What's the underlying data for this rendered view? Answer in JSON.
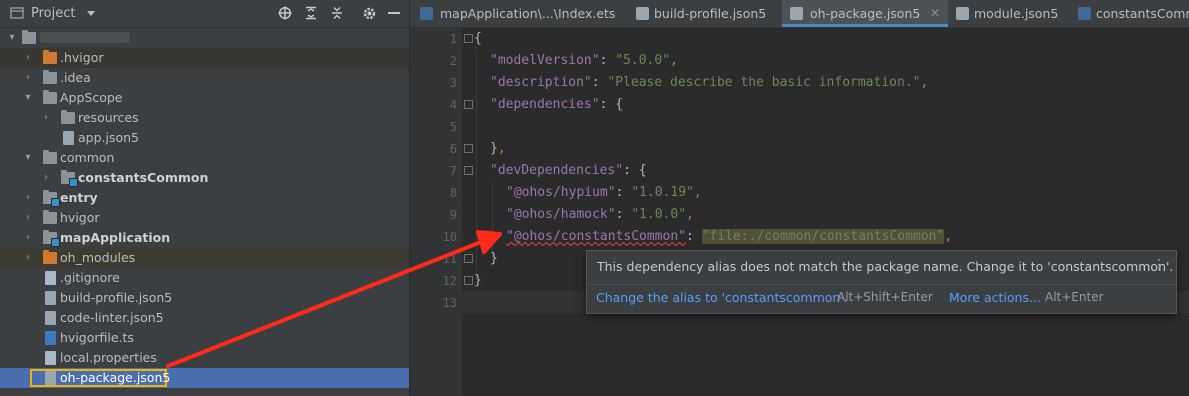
{
  "project_panel": {
    "title": "Project",
    "tree": [
      {
        "label": "",
        "type": "root-blurred"
      },
      {
        "label": ".hvigor",
        "type": "folder-orange"
      },
      {
        "label": ".idea",
        "type": "folder"
      },
      {
        "label": "AppScope",
        "type": "folder"
      },
      {
        "label": "resources",
        "type": "folder"
      },
      {
        "label": "app.json5",
        "type": "json"
      },
      {
        "label": "common",
        "type": "folder"
      },
      {
        "label": "constantsCommon",
        "type": "module"
      },
      {
        "label": "entry",
        "type": "module"
      },
      {
        "label": "hvigor",
        "type": "folder"
      },
      {
        "label": "mapApplication",
        "type": "module"
      },
      {
        "label": "oh_modules",
        "type": "folder-orange"
      },
      {
        "label": ".gitignore",
        "type": "file"
      },
      {
        "label": "build-profile.json5",
        "type": "json"
      },
      {
        "label": "code-linter.json5",
        "type": "json"
      },
      {
        "label": "hvigorfile.ts",
        "type": "ts"
      },
      {
        "label": "local.properties",
        "type": "props"
      },
      {
        "label": "oh-package.json5",
        "type": "json"
      }
    ]
  },
  "tabs": [
    {
      "label": "mapApplication\\...\\Index.ets",
      "icon": "ets-icon"
    },
    {
      "label": "build-profile.json5",
      "icon": "json-icon"
    },
    {
      "label": "oh-package.json5",
      "icon": "json-icon",
      "active": true
    },
    {
      "label": "module.json5",
      "icon": "json-icon"
    },
    {
      "label": "constantsComme",
      "icon": "ets-icon"
    }
  ],
  "line_numbers": [
    "1",
    "2",
    "3",
    "4",
    "5",
    "6",
    "7",
    "8",
    "9",
    "10",
    "11",
    "12",
    "13"
  ],
  "code": {
    "l1": "{",
    "l2_key": "\"modelVersion\"",
    "l2_val": "\"5.0.0\"",
    "l3_key": "\"description\"",
    "l3_val": "\"Please describe the basic information.\"",
    "l4_key": "\"dependencies\"",
    "l4_open": "{",
    "l6_close": "}",
    "l7_key": "\"devDependencies\"",
    "l7_open": "{",
    "l8_key": "\"@ohos/hypium\"",
    "l8_val": "\"1.0.19\"",
    "l9_key": "\"@ohos/hamock\"",
    "l9_val": "\"1.0.0\"",
    "l10_key": "\"@ohos/constantsCommon\"",
    "l10_val": "\"file:./common/constantsCommon\"",
    "l11_close": "}",
    "l12_close": "}",
    "colon": ": ",
    "comma": ","
  },
  "popup": {
    "message": "This dependency alias does not match the package name. Change it to 'constantscommon'.",
    "fix_link": "Change the alias to 'constantscommon'.",
    "fix_shortcut": "Alt+Shift+Enter",
    "more_link": "More actions...",
    "more_shortcut": "Alt+Enter",
    "more_icon": "vertical-dots-icon"
  },
  "colors": {
    "annotation_arrow": "#ff2a1a",
    "selection_highlight": "#f0b400",
    "link": "#589df6",
    "selected_row": "#4b6eaf"
  }
}
